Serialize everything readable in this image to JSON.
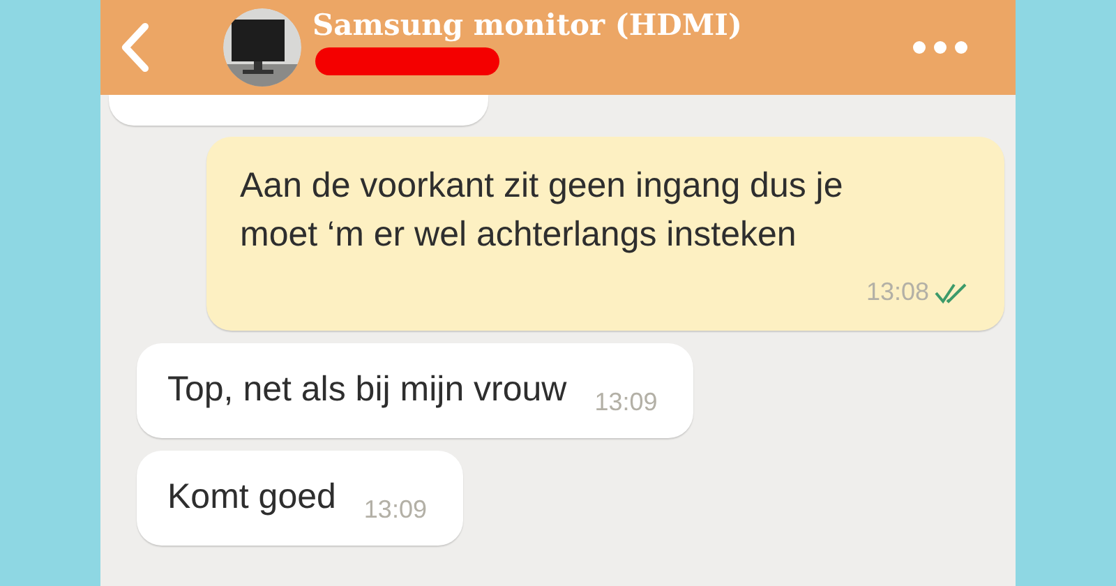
{
  "header": {
    "title": "Samsung monitor (HDMI)"
  },
  "messages": [
    {
      "kind": "cut_off"
    },
    {
      "kind": "outgoing",
      "text": "Aan de voorkant zit geen ingang dus je moet ‘m er wel achterlangs insteken",
      "time": "13:08",
      "read": true
    },
    {
      "kind": "incoming",
      "text": "Top, net als bij mijn vrouw",
      "time": "13:09"
    },
    {
      "kind": "incoming",
      "text": "Komt goed",
      "time": "13:09"
    }
  ]
}
